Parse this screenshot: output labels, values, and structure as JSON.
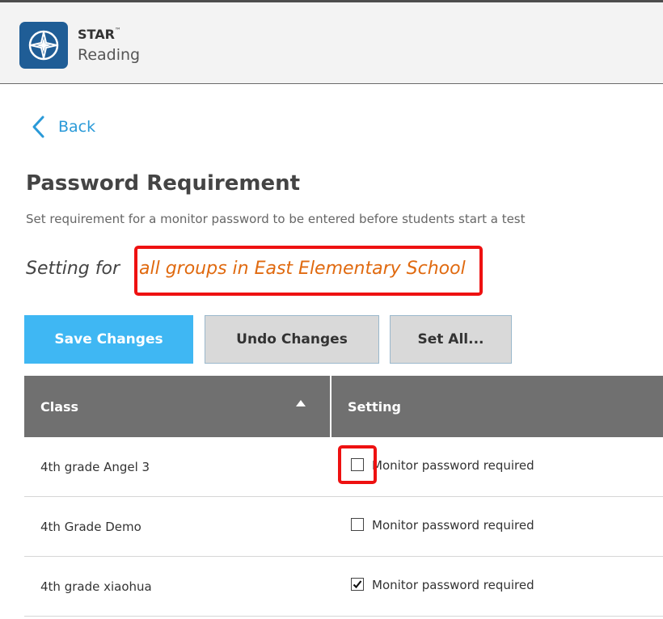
{
  "brand": {
    "name": "STAR",
    "tm": "™",
    "product": "Reading"
  },
  "nav": {
    "back_label": "Back"
  },
  "page": {
    "title": "Password Requirement",
    "description": "Set requirement for a monitor password to be entered before students start a test",
    "setting_for_label": "Setting for",
    "scope": "all groups in East Elementary School"
  },
  "buttons": {
    "save": "Save Changes",
    "undo": "Undo Changes",
    "set_all": "Set All..."
  },
  "table": {
    "columns": {
      "class": "Class",
      "setting": "Setting"
    },
    "sort": "ascending",
    "rows": [
      {
        "class": "4th grade Angel 3",
        "setting_label": "Monitor password required",
        "checked": false
      },
      {
        "class": "4th Grade Demo",
        "setting_label": "Monitor password required",
        "checked": false
      },
      {
        "class": "4th grade xiaohua",
        "setting_label": "Monitor password required",
        "checked": true
      }
    ]
  },
  "colors": {
    "accent": "#3fb7f3",
    "link": "#2a9ad8",
    "highlight": "#ee1111",
    "scope_text": "#e06a10",
    "header": "#707070"
  },
  "icons": {
    "logo": "compass-star-icon",
    "back": "chevron-left-icon",
    "sort": "sort-ascending-icon",
    "check": "checkmark-icon"
  }
}
